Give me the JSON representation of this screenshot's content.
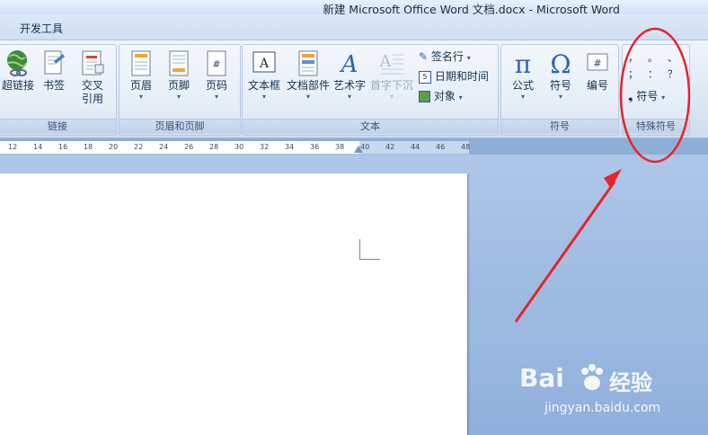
{
  "window": {
    "title": "新建 Microsoft Office Word 文档.docx - Microsoft Word"
  },
  "ribbon": {
    "active_tab": "开发工具",
    "groups": {
      "links": {
        "label": "链接",
        "buttons": [
          "超链接",
          "书签",
          "交叉\n引用"
        ]
      },
      "header_footer": {
        "label": "页眉和页脚",
        "buttons": [
          "页眉",
          "页脚",
          "页码"
        ]
      },
      "text": {
        "label": "文本",
        "buttons": [
          "文本框",
          "文档部件",
          "艺术字",
          "首字下沉"
        ],
        "small": [
          "签名行",
          "日期和时间",
          "对象"
        ]
      },
      "symbols": {
        "label": "符号",
        "buttons": [
          "公式",
          "符号",
          "编号"
        ]
      },
      "special": {
        "label": "特殊符号",
        "chars": [
          "，",
          "。",
          "、",
          "；",
          "：",
          "？"
        ],
        "dropdown": "符号"
      }
    }
  },
  "ruler": {
    "ticks": [
      "12",
      "14",
      "16",
      "18",
      "20",
      "22",
      "24",
      "26",
      "28",
      "30",
      "32",
      "34",
      "36",
      "38",
      "40",
      "42",
      "44",
      "46",
      "48"
    ]
  },
  "watermark": {
    "brand": "Bai",
    "brand2": "经验",
    "url": "jingyan.baidu.com"
  },
  "colors": {
    "annotation": "#e8232a",
    "accent": "#2a64b8"
  }
}
